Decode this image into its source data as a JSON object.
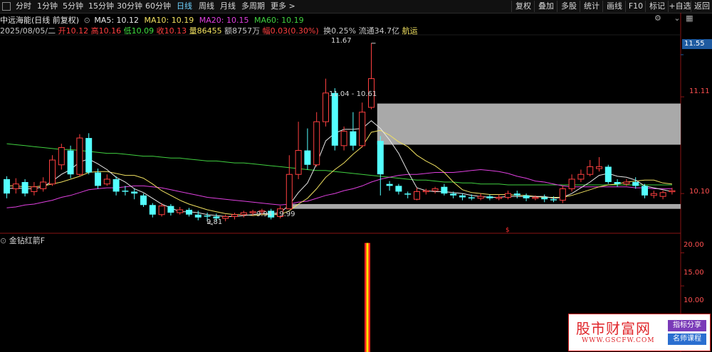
{
  "toolbar": {
    "tabs": [
      {
        "label": "分时",
        "active": false
      },
      {
        "label": "1分钟",
        "active": false
      },
      {
        "label": "5分钟",
        "active": false
      },
      {
        "label": "15分钟",
        "active": false
      },
      {
        "label": "30分钟",
        "active": false
      },
      {
        "label": "60分钟",
        "active": false
      },
      {
        "label": "日线",
        "active": true
      },
      {
        "label": "周线",
        "active": false
      },
      {
        "label": "月线",
        "active": false
      },
      {
        "label": "多周期",
        "active": false
      },
      {
        "label": "更多 >",
        "active": false
      }
    ],
    "buttons": [
      "复权",
      "叠加",
      "多股",
      "统计",
      "画线",
      "F10",
      "标记",
      "+自选",
      "返回"
    ]
  },
  "header": {
    "title": "中远海能(日线 前复权)",
    "ma": [
      {
        "label": "MA5: 10.12",
        "color": "#e8e8e8"
      },
      {
        "label": "MA10: 10.19",
        "color": "#f0e060"
      },
      {
        "label": "MA20: 10.15",
        "color": "#e040e0"
      },
      {
        "label": "MA60: 10.19",
        "color": "#40d040"
      }
    ],
    "quote": [
      {
        "text": "2025/08/05/二",
        "color": "#c8c8c8"
      },
      {
        "text": "开10.12",
        "color": "#ff4040"
      },
      {
        "text": "高10.16",
        "color": "#ff4040"
      },
      {
        "text": "低10.09",
        "color": "#40e040"
      },
      {
        "text": "收10.13",
        "color": "#ff4040"
      },
      {
        "text": "量86455",
        "color": "#f0e060"
      },
      {
        "text": "额8757万",
        "color": "#c8c8c8"
      },
      {
        "text": "幅0.03(0.30%)",
        "color": "#ff4040"
      },
      {
        "text": "换0.25%",
        "color": "#c8c8c8"
      },
      {
        "text": "流通34.7亿",
        "color": "#c8c8c8"
      },
      {
        "text": "航运",
        "color": "#f0e060"
      }
    ]
  },
  "price_axis": {
    "current_value": "11.55",
    "ticks": [
      "11.11",
      "10.10"
    ],
    "indicator_ticks": [
      "20.00",
      "15.00",
      "10.00"
    ]
  },
  "annotations": {
    "high": "11.67",
    "low": "9.81",
    "zone_upper": "11.04 - 10.61",
    "zone_lower": "9.94 - 9.99"
  },
  "indicator": {
    "name": "金钻红箭F"
  },
  "watermark": {
    "main": "股市财富网",
    "url": "WWW.GSCFW.COM",
    "tag1": "指标分享",
    "tag2": "名师课程"
  },
  "colors": {
    "up": "#ff4040",
    "down": "#54ffff",
    "ma5": "#e8e8e8",
    "ma10": "#f0e060",
    "ma20": "#e040e0",
    "ma60": "#40d040"
  },
  "chart_data": {
    "type": "candlestick",
    "y_range": [
      9.7,
      11.75
    ],
    "candles": [
      {
        "o": 10.25,
        "c": 10.1,
        "h": 10.28,
        "l": 10.05
      },
      {
        "o": 10.15,
        "c": 10.2,
        "h": 10.26,
        "l": 10.1
      },
      {
        "o": 10.22,
        "c": 10.1,
        "h": 10.25,
        "l": 10.07
      },
      {
        "o": 10.12,
        "c": 10.17,
        "h": 10.22,
        "l": 10.08
      },
      {
        "o": 10.15,
        "c": 10.22,
        "h": 10.27,
        "l": 10.12
      },
      {
        "o": 10.2,
        "c": 10.45,
        "h": 10.5,
        "l": 10.18
      },
      {
        "o": 10.4,
        "c": 10.58,
        "h": 10.62,
        "l": 10.35
      },
      {
        "o": 10.55,
        "c": 10.3,
        "h": 10.6,
        "l": 10.26
      },
      {
        "o": 10.3,
        "c": 10.68,
        "h": 10.72,
        "l": 10.28
      },
      {
        "o": 10.68,
        "c": 10.32,
        "h": 10.73,
        "l": 10.3
      },
      {
        "o": 10.32,
        "c": 10.18,
        "h": 10.36,
        "l": 10.15
      },
      {
        "o": 10.2,
        "c": 10.25,
        "h": 10.3,
        "l": 10.18
      },
      {
        "o": 10.25,
        "c": 10.12,
        "h": 10.28,
        "l": 10.08
      },
      {
        "o": 10.13,
        "c": 10.12,
        "h": 10.18,
        "l": 10.08
      },
      {
        "o": 10.12,
        "c": 10.1,
        "h": 10.15,
        "l": 10.04
      },
      {
        "o": 10.08,
        "c": 9.98,
        "h": 10.1,
        "l": 9.96
      },
      {
        "o": 9.98,
        "c": 9.88,
        "h": 10.0,
        "l": 9.85
      },
      {
        "o": 9.88,
        "c": 9.97,
        "h": 10.0,
        "l": 9.86
      },
      {
        "o": 9.97,
        "c": 9.9,
        "h": 9.99,
        "l": 9.87
      },
      {
        "o": 9.9,
        "c": 9.93,
        "h": 9.96,
        "l": 9.88
      },
      {
        "o": 9.93,
        "c": 9.88,
        "h": 9.95,
        "l": 9.86
      },
      {
        "o": 9.88,
        "c": 9.85,
        "h": 9.92,
        "l": 9.82
      },
      {
        "o": 9.87,
        "c": 9.86,
        "h": 9.9,
        "l": 9.81
      },
      {
        "o": 9.86,
        "c": 9.84,
        "h": 9.89,
        "l": 9.81
      },
      {
        "o": 9.84,
        "c": 9.86,
        "h": 9.88,
        "l": 9.81
      },
      {
        "o": 9.86,
        "c": 9.88,
        "h": 9.9,
        "l": 9.83
      },
      {
        "o": 9.88,
        "c": 9.9,
        "h": 9.92,
        "l": 9.85
      },
      {
        "o": 9.9,
        "c": 9.91,
        "h": 9.93,
        "l": 9.87
      },
      {
        "o": 9.91,
        "c": 9.92,
        "h": 9.94,
        "l": 9.88
      },
      {
        "o": 9.92,
        "c": 9.85,
        "h": 9.94,
        "l": 9.83
      },
      {
        "o": 9.86,
        "c": 9.94,
        "h": 9.97,
        "l": 9.84
      },
      {
        "o": 9.94,
        "c": 10.3,
        "h": 10.5,
        "l": 9.94
      },
      {
        "o": 10.3,
        "c": 10.55,
        "h": 10.85,
        "l": 10.25
      },
      {
        "o": 10.55,
        "c": 10.4,
        "h": 10.78,
        "l": 10.35
      },
      {
        "o": 10.4,
        "c": 10.85,
        "h": 10.95,
        "l": 10.38
      },
      {
        "o": 10.85,
        "c": 11.15,
        "h": 11.3,
        "l": 10.8
      },
      {
        "o": 11.15,
        "c": 10.6,
        "h": 11.2,
        "l": 10.55
      },
      {
        "o": 10.6,
        "c": 10.75,
        "h": 10.8,
        "l": 10.55
      },
      {
        "o": 10.75,
        "c": 10.6,
        "h": 10.95,
        "l": 10.55
      },
      {
        "o": 10.6,
        "c": 10.95,
        "h": 11.05,
        "l": 10.58
      },
      {
        "o": 11.0,
        "c": 11.3,
        "h": 11.67,
        "l": 10.98
      },
      {
        "o": 10.65,
        "c": 10.3,
        "h": 10.7,
        "l": 10.08
      },
      {
        "o": 10.2,
        "c": 10.18,
        "h": 10.23,
        "l": 10.13
      },
      {
        "o": 10.18,
        "c": 10.12,
        "h": 10.2,
        "l": 10.09
      },
      {
        "o": 10.1,
        "c": 10.09,
        "h": 10.12,
        "l": 10.05
      },
      {
        "o": 10.04,
        "c": 10.12,
        "h": 10.16,
        "l": 10.03
      },
      {
        "o": 10.12,
        "c": 10.13,
        "h": 10.15,
        "l": 10.09
      },
      {
        "o": 10.13,
        "c": 10.15,
        "h": 10.17,
        "l": 10.1
      },
      {
        "o": 10.17,
        "c": 10.1,
        "h": 10.2,
        "l": 10.08
      },
      {
        "o": 10.1,
        "c": 10.08,
        "h": 10.12,
        "l": 10.05
      },
      {
        "o": 10.08,
        "c": 10.06,
        "h": 10.1,
        "l": 10.03
      },
      {
        "o": 10.06,
        "c": 10.05,
        "h": 10.09,
        "l": 10.03
      },
      {
        "o": 10.05,
        "c": 10.07,
        "h": 10.1,
        "l": 10.03
      },
      {
        "o": 10.07,
        "c": 10.05,
        "h": 10.09,
        "l": 10.03
      },
      {
        "o": 10.05,
        "c": 10.06,
        "h": 10.09,
        "l": 10.03
      },
      {
        "o": 10.06,
        "c": 10.1,
        "h": 10.13,
        "l": 10.04
      },
      {
        "o": 10.1,
        "c": 10.08,
        "h": 10.13,
        "l": 10.05
      },
      {
        "o": 10.08,
        "c": 10.05,
        "h": 10.1,
        "l": 10.02
      },
      {
        "o": 10.05,
        "c": 10.06,
        "h": 10.08,
        "l": 10.03
      },
      {
        "o": 10.06,
        "c": 10.04,
        "h": 10.09,
        "l": 10.01
      },
      {
        "o": 10.04,
        "c": 10.03,
        "h": 10.07,
        "l": 10.01
      },
      {
        "o": 10.03,
        "c": 10.15,
        "h": 10.18,
        "l": 10.0
      },
      {
        "o": 10.15,
        "c": 10.25,
        "h": 10.3,
        "l": 10.12
      },
      {
        "o": 10.25,
        "c": 10.3,
        "h": 10.35,
        "l": 10.22
      },
      {
        "o": 10.3,
        "c": 10.38,
        "h": 10.45,
        "l": 10.28
      },
      {
        "o": 10.36,
        "c": 10.38,
        "h": 10.48,
        "l": 10.33
      },
      {
        "o": 10.38,
        "c": 10.22,
        "h": 10.4,
        "l": 10.2
      },
      {
        "o": 10.22,
        "c": 10.2,
        "h": 10.25,
        "l": 10.17
      },
      {
        "o": 10.2,
        "c": 10.22,
        "h": 10.25,
        "l": 10.18
      },
      {
        "o": 10.22,
        "c": 10.18,
        "h": 10.27,
        "l": 10.15
      },
      {
        "o": 10.18,
        "c": 10.08,
        "h": 10.2,
        "l": 10.05
      },
      {
        "o": 10.08,
        "c": 10.1,
        "h": 10.13,
        "l": 10.05
      },
      {
        "o": 10.07,
        "c": 10.11,
        "h": 10.13,
        "l": 10.04
      },
      {
        "o": 10.12,
        "c": 10.13,
        "h": 10.16,
        "l": 10.09
      }
    ],
    "ma5": [
      10.15,
      10.16,
      10.15,
      10.15,
      10.17,
      10.23,
      10.3,
      10.35,
      10.43,
      10.46,
      10.41,
      10.35,
      10.27,
      10.22,
      10.15,
      10.11,
      10.05,
      9.99,
      9.95,
      9.91,
      9.91,
      9.9,
      9.88,
      9.87,
      9.86,
      9.86,
      9.87,
      9.88,
      9.89,
      9.89,
      9.9,
      9.98,
      10.11,
      10.21,
      10.41,
      10.65,
      10.73,
      10.77,
      10.77,
      10.78,
      10.86,
      10.78,
      10.66,
      10.52,
      10.33,
      10.16,
      10.13,
      10.12,
      10.12,
      10.11,
      10.1,
      10.08,
      10.07,
      10.06,
      10.06,
      10.07,
      10.07,
      10.07,
      10.07,
      10.07,
      10.05,
      10.06,
      10.1,
      10.16,
      10.22,
      10.29,
      10.31,
      10.28,
      10.27,
      10.24,
      10.18,
      10.16,
      10.14,
      10.12
    ],
    "ma10": [
      10.18,
      10.18,
      10.17,
      10.17,
      10.18,
      10.2,
      10.22,
      10.25,
      10.28,
      10.32,
      10.33,
      10.33,
      10.31,
      10.29,
      10.29,
      10.26,
      10.2,
      10.13,
      10.08,
      10.03,
      9.99,
      9.96,
      9.93,
      9.91,
      9.89,
      9.88,
      9.88,
      9.87,
      9.88,
      9.88,
      9.88,
      9.92,
      9.99,
      10.05,
      10.15,
      10.27,
      10.35,
      10.42,
      10.51,
      10.59,
      10.74,
      10.76,
      10.71,
      10.64,
      10.59,
      10.5,
      10.44,
      10.39,
      10.32,
      10.22,
      10.14,
      10.11,
      10.1,
      10.09,
      10.09,
      10.09,
      10.08,
      10.08,
      10.07,
      10.06,
      10.06,
      10.06,
      10.08,
      10.11,
      10.14,
      10.17,
      10.19,
      10.2,
      10.22,
      10.23,
      10.24,
      10.24,
      10.21,
      10.2
    ],
    "ma20": [
      9.95,
      9.96,
      9.98,
      9.99,
      10.01,
      10.03,
      10.06,
      10.08,
      10.11,
      10.14,
      10.15,
      10.16,
      10.16,
      10.17,
      10.18,
      10.18,
      10.17,
      10.16,
      10.14,
      10.12,
      10.1,
      10.08,
      10.06,
      10.05,
      10.04,
      10.03,
      10.02,
      10.01,
      10.0,
      9.99,
      9.98,
      9.99,
      10.01,
      10.02,
      10.05,
      10.08,
      10.1,
      10.13,
      10.15,
      10.18,
      10.22,
      10.25,
      10.27,
      10.29,
      10.3,
      10.3,
      10.31,
      10.32,
      10.32,
      10.32,
      10.33,
      10.34,
      10.35,
      10.34,
      10.33,
      10.31,
      10.28,
      10.26,
      10.23,
      10.22,
      10.2,
      10.18,
      10.17,
      10.17,
      10.17,
      10.17,
      10.17,
      10.17,
      10.17,
      10.16,
      10.16,
      10.15,
      10.15,
      10.15
    ],
    "ma60": [
      10.62,
      10.61,
      10.6,
      10.59,
      10.58,
      10.57,
      10.56,
      10.56,
      10.55,
      10.54,
      10.53,
      10.52,
      10.52,
      10.51,
      10.5,
      10.49,
      10.49,
      10.48,
      10.47,
      10.47,
      10.46,
      10.45,
      10.44,
      10.44,
      10.43,
      10.42,
      10.42,
      10.41,
      10.4,
      10.39,
      10.38,
      10.37,
      10.36,
      10.35,
      10.34,
      10.34,
      10.33,
      10.32,
      10.31,
      10.3,
      10.29,
      10.28,
      10.27,
      10.26,
      10.25,
      10.24,
      10.24,
      10.23,
      10.22,
      10.22,
      10.21,
      10.21,
      10.2,
      10.2,
      10.2,
      10.19,
      10.19,
      10.19,
      10.19,
      10.19,
      10.19,
      10.19,
      10.19,
      10.19,
      10.19,
      10.19,
      10.19,
      10.19,
      10.19,
      10.19,
      10.19,
      10.19,
      10.19,
      10.19
    ],
    "zones": [
      {
        "label": "11.04 - 10.61",
        "top": 11.04,
        "bottom": 10.61,
        "start_index": 41
      },
      {
        "label": "9.94 - 9.99",
        "top": 9.99,
        "bottom": 9.94,
        "start_index": 31
      }
    ],
    "indicator_y_range": [
      5,
      22
    ],
    "indicator_signal": {
      "index": 40,
      "value": 21.5
    }
  }
}
